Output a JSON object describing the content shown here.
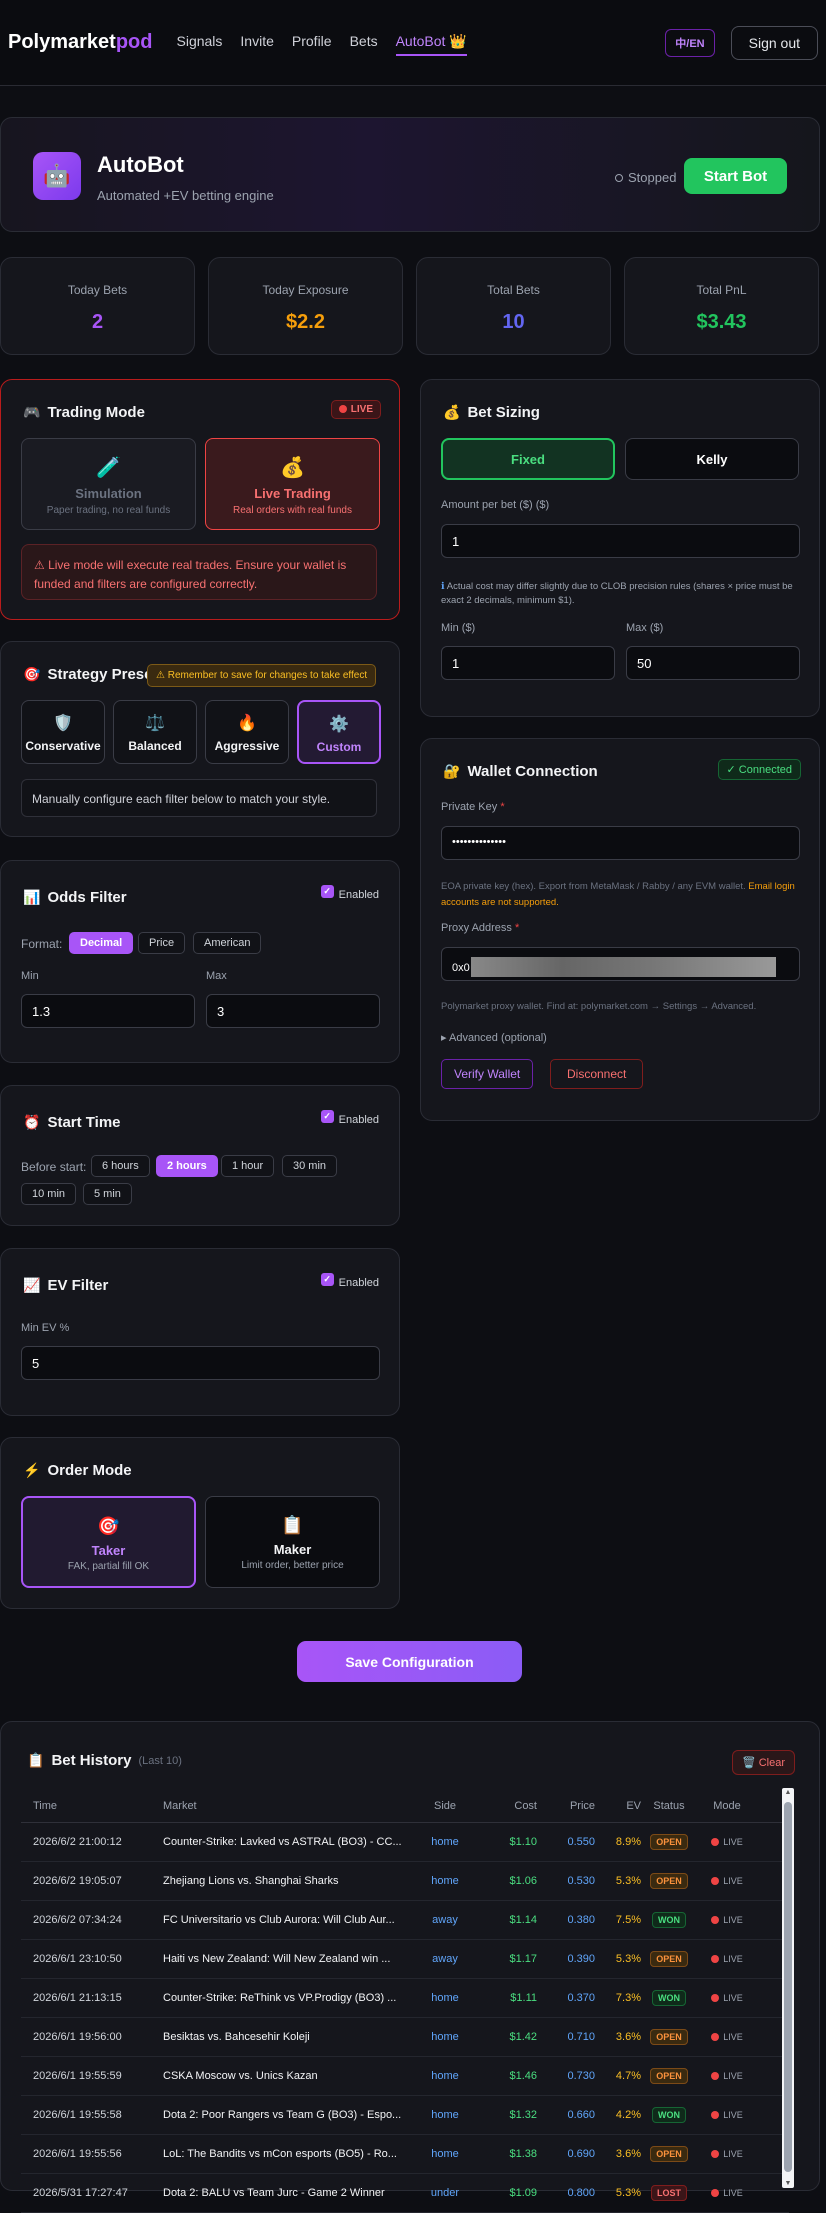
{
  "nav": {
    "brand_a": "Polymarket",
    "brand_b": "pod",
    "links": [
      "Signals",
      "Invite",
      "Profile",
      "Bets",
      "AutoBot"
    ],
    "crown": "👑",
    "lang": "中/EN",
    "signout": "Sign out"
  },
  "hero": {
    "title": "AutoBot",
    "subtitle": "Automated +EV betting engine",
    "status": "Stopped",
    "start": "Start Bot",
    "avatar": "🤖"
  },
  "stats": [
    {
      "label": "Today Bets",
      "value": "2",
      "color": "#a855f7"
    },
    {
      "label": "Today Exposure",
      "value": "$2.2",
      "color": "#f59e0b"
    },
    {
      "label": "Total Bets",
      "value": "10",
      "color": "#6366f1"
    },
    {
      "label": "Total PnL",
      "value": "$3.43",
      "color": "#22c55e"
    }
  ],
  "trading": {
    "title": "Trading Mode",
    "icon": "🎮",
    "badge": "LIVE",
    "sim_title": "Simulation",
    "sim_desc": "Paper trading, no real funds",
    "sim_icon": "🧪",
    "live_title": "Live Trading",
    "live_desc": "Real orders with real funds",
    "live_icon": "💰",
    "warning": "Live mode will execute real trades. Ensure your wallet is funded and filters are configured correctly."
  },
  "strategy": {
    "title": "Strategy Preset",
    "icon": "🎯",
    "hint": "Remember to save for changes to take effect",
    "presets": [
      {
        "label": "Conservative",
        "icon": "🛡️"
      },
      {
        "label": "Balanced",
        "icon": "⚖️"
      },
      {
        "label": "Aggressive",
        "icon": "🔥"
      },
      {
        "label": "Custom",
        "icon": "⚙️"
      }
    ],
    "desc": "Manually configure each filter below to match your style."
  },
  "odds": {
    "title": "Odds Filter",
    "icon": "📊",
    "enabled": "Enabled",
    "format_label": "Format:",
    "formats": [
      "Decimal",
      "Price",
      "American"
    ],
    "min_label": "Min",
    "max_label": "Max",
    "min": "1.3",
    "max": "3"
  },
  "start": {
    "title": "Start Time",
    "icon": "⏰",
    "enabled": "Enabled",
    "before_label": "Before start:",
    "options": [
      "6 hours",
      "2 hours",
      "1 hour",
      "30 min",
      "10 min",
      "5 min"
    ]
  },
  "ev": {
    "title": "EV Filter",
    "icon": "📈",
    "enabled": "Enabled",
    "label": "Min EV %",
    "value": "5"
  },
  "order": {
    "title": "Order Mode",
    "icon": "⚡",
    "taker": "Taker",
    "taker_desc": "FAK, partial fill OK",
    "taker_icon": "🎯",
    "maker": "Maker",
    "maker_desc": "Limit order, better price",
    "maker_icon": "📋"
  },
  "sizing": {
    "title": "Bet Sizing",
    "icon": "💰",
    "fixed": "Fixed",
    "kelly": "Kelly",
    "amount_label": "Amount per bet ($) ($)",
    "amount": "1",
    "note": "Actual cost may differ slightly due to CLOB precision rules (shares × price must be exact 2 decimals, minimum $1).",
    "min_label": "Min ($)",
    "max_label": "Max ($)",
    "min": "1",
    "max": "50"
  },
  "wallet": {
    "title": "Wallet Connection",
    "icon": "🔐",
    "connected": "✓ Connected",
    "pk_label": "Private Key",
    "pk_value": "••••••••••••••",
    "pk_note": "EOA private key (hex). Export from MetaMask / Rabby / any EVM wallet.",
    "pk_warn": "Email login accounts are not supported.",
    "proxy_label": "Proxy Address",
    "proxy_value": "0x0",
    "proxy_note": "Polymarket proxy wallet. Find at: polymarket.com → Settings → Advanced.",
    "advanced": "Advanced (optional)",
    "verify": "Verify Wallet",
    "disconnect": "Disconnect"
  },
  "save": "Save Configuration",
  "history": {
    "title": "Bet History",
    "sub": "(Last 10)",
    "icon": "📋",
    "clear": "Clear",
    "clear_icon": "🗑️",
    "headers": [
      "Time",
      "Market",
      "Side",
      "Cost",
      "Price",
      "EV",
      "Status",
      "Mode"
    ],
    "rows": [
      [
        "2026/6/2 21:00:12",
        "Counter-Strike: Lavked vs ASTRAL (BO3) - CC...",
        "home",
        "$1.10",
        "0.550",
        "8.9%",
        "OPEN",
        "LIVE"
      ],
      [
        "2026/6/2 19:05:07",
        "Zhejiang Lions vs. Shanghai Sharks",
        "home",
        "$1.06",
        "0.530",
        "5.3%",
        "OPEN",
        "LIVE"
      ],
      [
        "2026/6/2 07:34:24",
        "FC Universitario vs Club Aurora: Will Club Aur...",
        "away",
        "$1.14",
        "0.380",
        "7.5%",
        "WON",
        "LIVE"
      ],
      [
        "2026/6/1 23:10:50",
        "Haiti vs New Zealand: Will New Zealand win ...",
        "away",
        "$1.17",
        "0.390",
        "5.3%",
        "OPEN",
        "LIVE"
      ],
      [
        "2026/6/1 21:13:15",
        "Counter-Strike: ReThink vs VP.Prodigy (BO3) ...",
        "home",
        "$1.11",
        "0.370",
        "7.3%",
        "WON",
        "LIVE"
      ],
      [
        "2026/6/1 19:56:00",
        "Besiktas vs. Bahcesehir Koleji",
        "home",
        "$1.42",
        "0.710",
        "3.6%",
        "OPEN",
        "LIVE"
      ],
      [
        "2026/6/1 19:55:59",
        "CSKA Moscow vs. Unics Kazan",
        "home",
        "$1.46",
        "0.730",
        "4.7%",
        "OPEN",
        "LIVE"
      ],
      [
        "2026/6/1 19:55:58",
        "Dota 2: Poor Rangers vs Team G (BO3) - Espo...",
        "home",
        "$1.32",
        "0.660",
        "4.2%",
        "WON",
        "LIVE"
      ],
      [
        "2026/6/1 19:55:56",
        "LoL: The Bandits vs mCon esports (BO5) - Ro...",
        "home",
        "$1.38",
        "0.690",
        "3.6%",
        "OPEN",
        "LIVE"
      ],
      [
        "2026/5/31 17:27:47",
        "Dota 2: BALU vs Team Jurc - Game 2 Winner",
        "under",
        "$1.09",
        "0.800",
        "5.3%",
        "LOST",
        "LIVE"
      ]
    ]
  }
}
